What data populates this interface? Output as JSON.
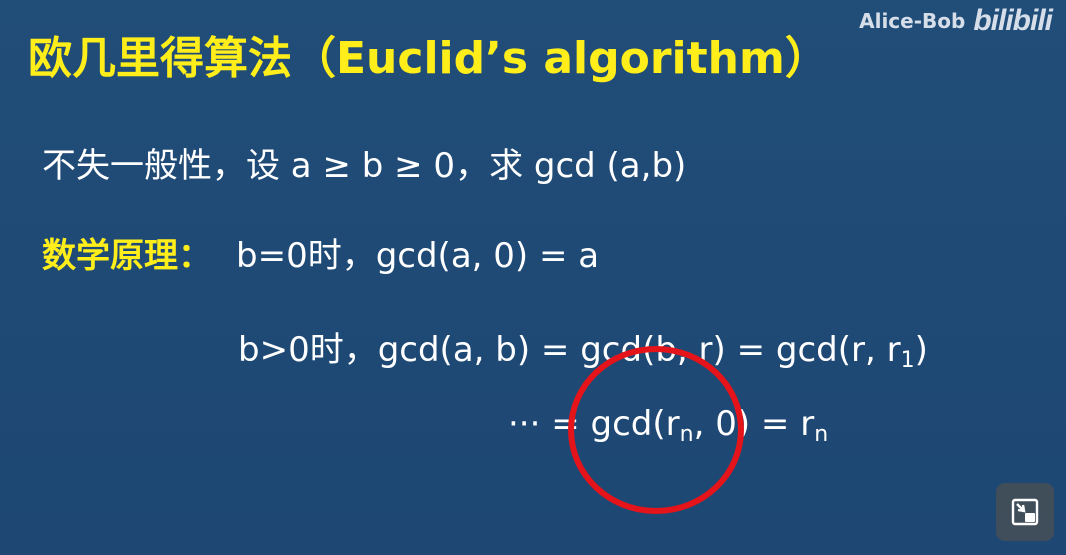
{
  "title": "欧几里得算法（Euclid’s algorithm）",
  "watermark": {
    "user": "Alice-Bob",
    "brand": "bilibili"
  },
  "content": {
    "line1": "不失一般性，设 a ≥ b ≥ 0，求 gcd (a,b)",
    "line2_label": "数学原理：",
    "line2_text": "b=0时，gcd(a, 0) = a",
    "line3_main": "b>0时，gcd(a, b) = gcd(b, r) = gcd(r, r",
    "line3_sub": "1",
    "line3_close": ")",
    "line4_pre": "··· = gcd(r",
    "line4_sub1": "n",
    "line4_mid": ", 0) = r",
    "line4_sub2": "n"
  },
  "annotation": {
    "circle_color": "#e4141a"
  },
  "controls": {
    "pip_icon": "picture-in-picture-icon"
  },
  "colors": {
    "background": "#1f4a76",
    "title": "#ffee1a",
    "text": "#ffffff"
  }
}
